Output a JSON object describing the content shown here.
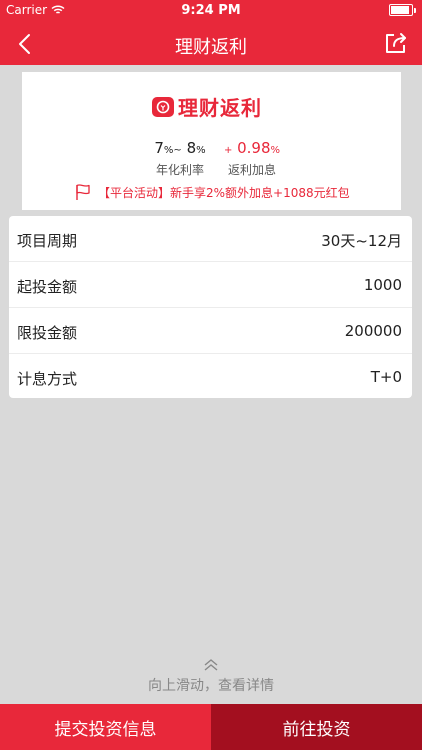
{
  "status_bar": {
    "carrier": "Carrier",
    "time": "9:24 PM",
    "battery_level": 1.0
  },
  "nav": {
    "title": "理财返利",
    "back_icon": "chevron-left-icon",
    "share_icon": "share-icon"
  },
  "product": {
    "logo_text": "理财返利",
    "rate": {
      "min": "7",
      "max": "8",
      "unit": "%",
      "separator": "~",
      "label": "年化利率"
    },
    "bonus": {
      "sign": "+",
      "value": "0.98",
      "unit": "%",
      "label": "返利加息"
    },
    "promo_text": "【平台活动】新手享2%额外加息+1088元红包"
  },
  "details": [
    {
      "label": "项目周期",
      "value": "30天~12月"
    },
    {
      "label": "起投金额",
      "value": "1000"
    },
    {
      "label": "限投金额",
      "value": "200000"
    },
    {
      "label": "计息方式",
      "value": "T+0"
    }
  ],
  "slide_hint": "向上滑动，查看详情",
  "bottom": {
    "submit_label": "提交投资信息",
    "invest_label": "前往投资"
  },
  "colors": {
    "brand_red": "#e8283a",
    "dark_red": "#a30f1f"
  }
}
